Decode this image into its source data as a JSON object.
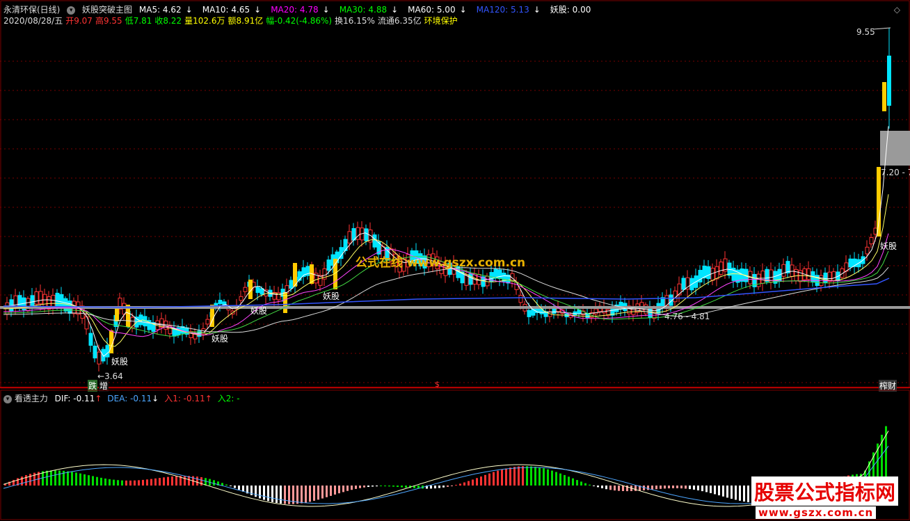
{
  "header": {
    "stock_name": "永清环保(日线)",
    "indicator_name": "妖股突破主图",
    "ma_items": [
      {
        "label": "MA5: 4.62",
        "arrow": "↓",
        "color": "#ffffff",
        "arrow_color": "#ffffff"
      },
      {
        "label": "MA10: 4.65",
        "arrow": "↓",
        "color": "#ffffff",
        "arrow_color": "#ffffff"
      },
      {
        "label": "MA20: 4.78",
        "arrow": "↓",
        "color": "#ff00ff",
        "arrow_color": "#ffffff"
      },
      {
        "label": "MA30: 4.88",
        "arrow": "↓",
        "color": "#00ff00",
        "arrow_color": "#ffffff"
      },
      {
        "label": "MA60: 5.00",
        "arrow": "↓",
        "color": "#ffffff",
        "arrow_color": "#ffffff"
      },
      {
        "label": "MA120: 5.13",
        "arrow": "↓",
        "color": "#3355ff",
        "arrow_color": "#ffffff"
      },
      {
        "label": "妖股: 0.00",
        "arrow": "",
        "color": "#ffffff",
        "arrow_color": "#ffffff"
      }
    ],
    "quote_items": [
      {
        "text": "2020/08/28/五",
        "color": "#dddddd"
      },
      {
        "text": "开9.07",
        "color": "#ff3333"
      },
      {
        "text": "高9.55",
        "color": "#ff3333"
      },
      {
        "text": "低7.81",
        "color": "#00ff00"
      },
      {
        "text": "收8.22",
        "color": "#00ff00"
      },
      {
        "text": "量102.6万",
        "color": "#ffff00"
      },
      {
        "text": "额8.91亿",
        "color": "#ffff00"
      },
      {
        "text": "幅-0.42(-4.86%)",
        "color": "#00ff00"
      },
      {
        "text": "换16.15%",
        "color": "#dddddd"
      },
      {
        "text": "流通6.35亿",
        "color": "#dddddd"
      },
      {
        "text": "环境保护",
        "color": "#ffff00"
      }
    ]
  },
  "main_chart": {
    "price_high_label": "9.55",
    "price_low_label": "3.64",
    "range_label_right": "7.20 - 7",
    "range_label_mid": "4.76 - 4.81",
    "signal_label": "妖股",
    "bottom_tags": [
      "跌",
      "增",
      "$",
      "榨财"
    ],
    "watermark": "公式在线 www.gszx.com.cn"
  },
  "sub_chart": {
    "indicator_name": "看透主力",
    "items": [
      {
        "label": "DIF: -0.11",
        "arrow": "↑",
        "color": "#ffffff",
        "arrow_color": "#ff3333"
      },
      {
        "label": "DEA: -0.11",
        "arrow": "↓",
        "color": "#4da6ff",
        "arrow_color": "#ffffff"
      },
      {
        "label": "入1: -0.11",
        "arrow": "↑",
        "color": "#ff3333",
        "arrow_color": "#ff3333"
      },
      {
        "label": "入2: -",
        "arrow": "",
        "color": "#00ff00",
        "arrow_color": "#00ff00"
      }
    ],
    "watermark_cn": "股票公式指标网",
    "watermark_url": "www.gszx.com.cn"
  },
  "colors": {
    "up": "#ff3333",
    "down": "#00e5ff",
    "signal": "#ffcc00",
    "grid": "#7a0000"
  }
}
